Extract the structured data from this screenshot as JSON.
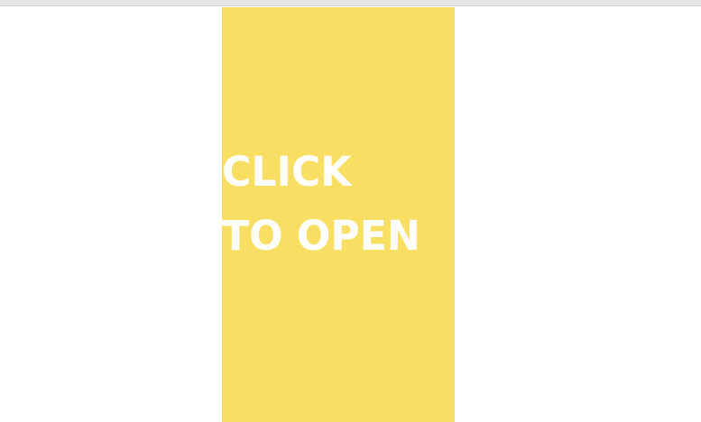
{
  "panel": {
    "line1": "Click",
    "line2": "to open"
  },
  "colors": {
    "panel": "#f8df63",
    "text": "#ffffff",
    "background": "#ffffff"
  }
}
